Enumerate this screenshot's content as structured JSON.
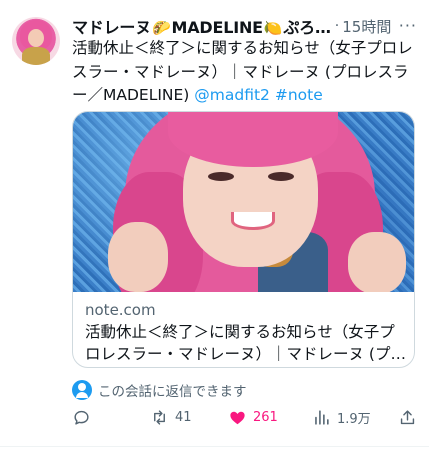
{
  "tweet": {
    "author": {
      "display_name": "マドレーヌ🌮MADELINE🍋ぷろ…",
      "name_part1": "マドレーヌ",
      "emoji1": "🌮",
      "name_part2": "MADELINE",
      "emoji2": "🍋",
      "name_part3": "ぷろ…"
    },
    "separator": "·",
    "time": "15時間",
    "more_label": "···",
    "text_main": "活動休止＜終了＞に関するお知らせ（女子プロレスラー・マドレーヌ）｜マドレーヌ (プロレスラー／MADELINE) ",
    "mention": "@madfit2",
    "hashtag": "#note",
    "card": {
      "domain": "note.com",
      "title": "活動休止＜終了＞に関するお知らせ（女子プロレスラー・マドレーヌ）｜マドレーヌ (プ…"
    },
    "reply_note": "この会話に返信できます",
    "actions": {
      "replies": "",
      "retweets": "41",
      "likes": "261",
      "views": "1.9万",
      "share": ""
    }
  },
  "colors": {
    "accent": "#1d9bf0",
    "like": "#f91880",
    "muted": "#536471",
    "text": "#0f1419"
  }
}
